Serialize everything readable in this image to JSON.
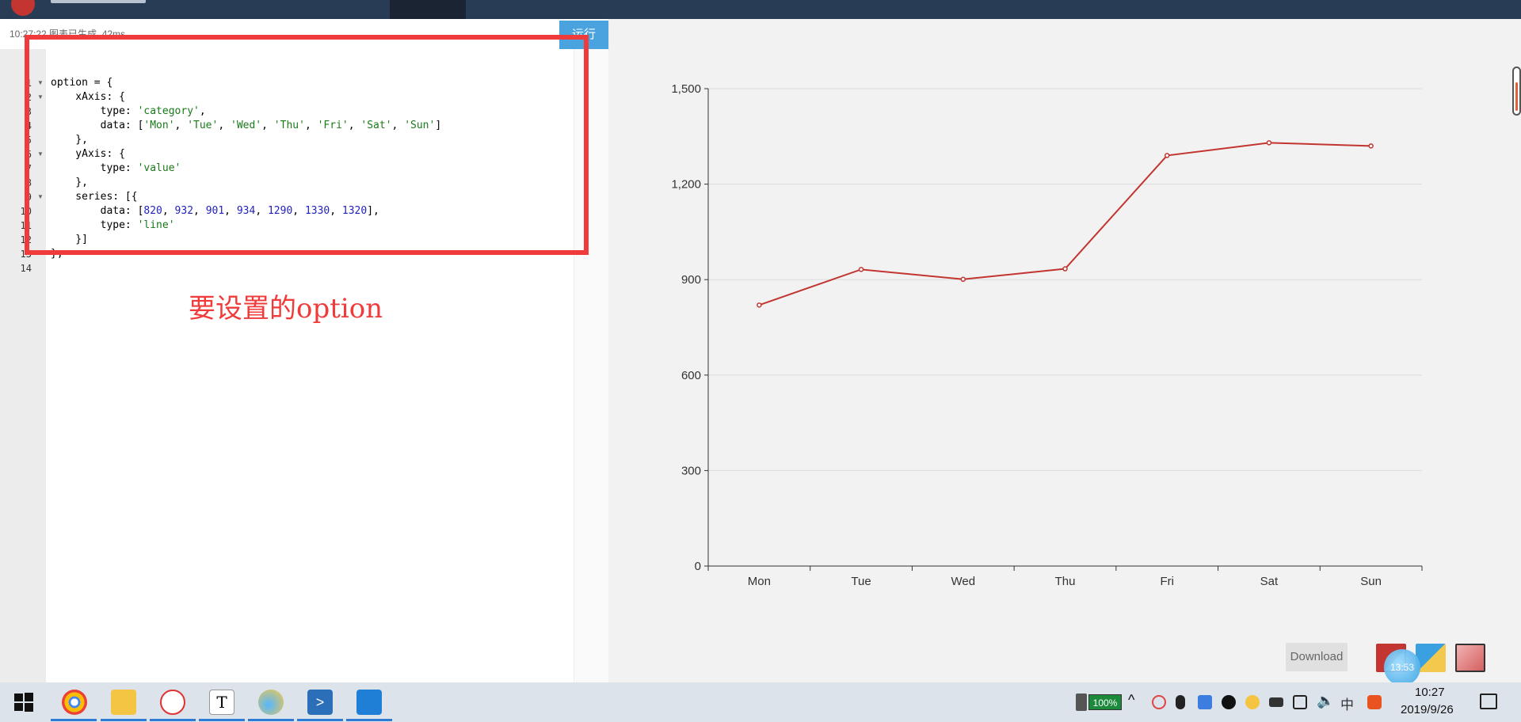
{
  "editor": {
    "status": "10:27:22  图表已生成, 42ms",
    "run_label": "运行",
    "lines": [
      {
        "n": "1",
        "fold": true,
        "parts": [
          {
            "t": "option = {"
          }
        ]
      },
      {
        "n": "2",
        "fold": true,
        "parts": [
          {
            "t": "    xAxis: {"
          }
        ]
      },
      {
        "n": "3",
        "fold": false,
        "parts": [
          {
            "t": "        type: "
          },
          {
            "t": "'category'",
            "k": "str"
          },
          {
            "t": ","
          }
        ]
      },
      {
        "n": "4",
        "fold": false,
        "parts": [
          {
            "t": "        data: ["
          },
          {
            "t": "'Mon'",
            "k": "str"
          },
          {
            "t": ", "
          },
          {
            "t": "'Tue'",
            "k": "str"
          },
          {
            "t": ", "
          },
          {
            "t": "'Wed'",
            "k": "str"
          },
          {
            "t": ", "
          },
          {
            "t": "'Thu'",
            "k": "str"
          },
          {
            "t": ", "
          },
          {
            "t": "'Fri'",
            "k": "str"
          },
          {
            "t": ", "
          },
          {
            "t": "'Sat'",
            "k": "str"
          },
          {
            "t": ", "
          },
          {
            "t": "'Sun'",
            "k": "str"
          },
          {
            "t": "]"
          }
        ]
      },
      {
        "n": "5",
        "fold": false,
        "parts": [
          {
            "t": "    },"
          }
        ]
      },
      {
        "n": "6",
        "fold": true,
        "parts": [
          {
            "t": "    yAxis: {"
          }
        ]
      },
      {
        "n": "7",
        "fold": false,
        "parts": [
          {
            "t": "        type: "
          },
          {
            "t": "'value'",
            "k": "str"
          }
        ]
      },
      {
        "n": "8",
        "fold": false,
        "parts": [
          {
            "t": "    },"
          }
        ]
      },
      {
        "n": "9",
        "fold": true,
        "parts": [
          {
            "t": "    series: [{"
          }
        ]
      },
      {
        "n": "10",
        "fold": false,
        "parts": [
          {
            "t": "        data: ["
          },
          {
            "t": "820",
            "k": "num"
          },
          {
            "t": ", "
          },
          {
            "t": "932",
            "k": "num"
          },
          {
            "t": ", "
          },
          {
            "t": "901",
            "k": "num"
          },
          {
            "t": ", "
          },
          {
            "t": "934",
            "k": "num"
          },
          {
            "t": ", "
          },
          {
            "t": "1290",
            "k": "num"
          },
          {
            "t": ", "
          },
          {
            "t": "1330",
            "k": "num"
          },
          {
            "t": ", "
          },
          {
            "t": "1320",
            "k": "num"
          },
          {
            "t": "],"
          }
        ]
      },
      {
        "n": "11",
        "fold": false,
        "parts": [
          {
            "t": "        type: "
          },
          {
            "t": "'line'",
            "k": "str"
          }
        ]
      },
      {
        "n": "12",
        "fold": false,
        "parts": [
          {
            "t": "    }]"
          }
        ]
      },
      {
        "n": "13",
        "fold": false,
        "parts": [
          {
            "t": "};"
          }
        ]
      },
      {
        "n": "14",
        "fold": false,
        "parts": [
          {
            "t": ""
          }
        ]
      }
    ]
  },
  "annotation": {
    "text": "要设置的option",
    "color": "#ef3b3b"
  },
  "chart_data": {
    "type": "line",
    "categories": [
      "Mon",
      "Tue",
      "Wed",
      "Thu",
      "Fri",
      "Sat",
      "Sun"
    ],
    "values": [
      820,
      932,
      901,
      934,
      1290,
      1330,
      1320
    ],
    "ylim": [
      0,
      1500
    ],
    "yticks": [
      0,
      300,
      600,
      900,
      1200,
      1500
    ],
    "ytick_labels": [
      "0",
      "300",
      "600",
      "900",
      "1,200",
      "1,500"
    ],
    "grid": true,
    "line_color": "#c23531"
  },
  "chart_panel": {
    "download_label": "Download",
    "clock_bubble": "13:53",
    "theme_colors": [
      "#c23531",
      "#f2c94c",
      "#d46060"
    ]
  },
  "taskbar": {
    "battery": "100%",
    "ime": "中",
    "time": "10:27",
    "date": "2019/9/26",
    "accent": "#2e7bd6"
  }
}
